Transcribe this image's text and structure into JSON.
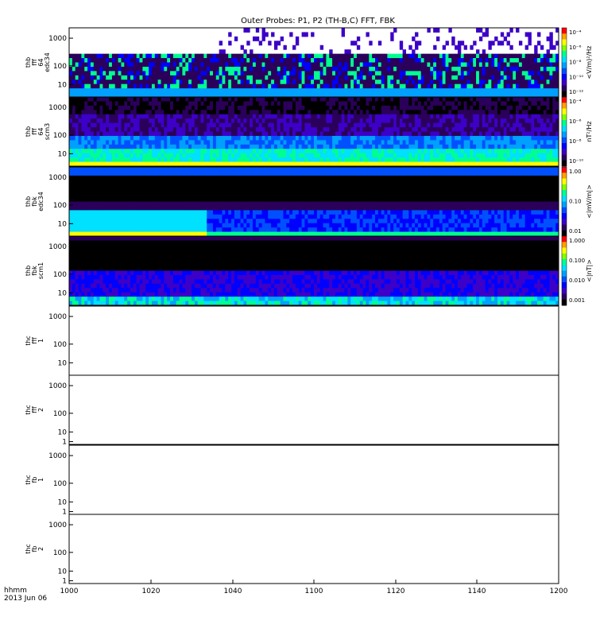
{
  "figure": {
    "title": "Outer Probes: P1, P2 (TH-B,C) FFT, FBK",
    "time_axis": {
      "ticks": [
        1000,
        1020,
        1040,
        1100,
        1120,
        1140,
        1200
      ],
      "tick_labels": [
        "1000",
        "1020",
        "1040",
        "1100",
        "1120",
        "1140",
        "1200"
      ],
      "unit_label": "hhmm",
      "date_label": "2013 Jun 06"
    }
  },
  "colors": {
    "axis": "#000000",
    "colormap": [
      "#000000",
      "#2a005a",
      "#3c00c8",
      "#0000ff",
      "#0050ff",
      "#00a0ff",
      "#00e0ff",
      "#00ff90",
      "#80ff00",
      "#ffff00",
      "#ffa000",
      "#ff0000"
    ]
  },
  "chart_data": [
    {
      "type": "heatmap",
      "ylabel": [
        "thb",
        "fff",
        "64",
        "edc34"
      ],
      "yscale": "log",
      "yticks": [
        "10",
        "100",
        "1000"
      ],
      "colorbar": {
        "label": "<V/m)²/Hz",
        "ticks": [
          "10⁻⁴",
          "10⁻⁶",
          "10⁻⁸",
          "10⁻¹⁰",
          "10⁻¹²"
        ]
      },
      "pattern": "sparse",
      "has_data": true
    },
    {
      "type": "heatmap",
      "ylabel": [
        "thb",
        "fff",
        "64",
        "scm3"
      ],
      "yscale": "log",
      "yticks": [
        "10",
        "100",
        "1000"
      ],
      "colorbar": {
        "label": "nT²/Hz",
        "ticks": [
          "10⁻⁴",
          "10⁻⁶",
          "10⁻⁸",
          "10⁻¹⁰"
        ]
      },
      "pattern": "dense",
      "has_data": true
    },
    {
      "type": "heatmap",
      "ylabel": [
        "thb",
        "fbk",
        "edc34"
      ],
      "yscale": "log",
      "yticks": [
        "10",
        "100",
        "1000"
      ],
      "colorbar": {
        "label": "<|mV/m|>",
        "ticks": [
          "1.00",
          "0.10",
          "0.01"
        ]
      },
      "pattern": "fbk_e",
      "has_data": true
    },
    {
      "type": "heatmap",
      "ylabel": [
        "thb",
        "fbk",
        "scm1"
      ],
      "yscale": "log",
      "yticks": [
        "10",
        "100",
        "1000"
      ],
      "colorbar": {
        "label": "<|nT|>",
        "ticks": [
          "1.000",
          "0.100",
          "0.010",
          "0.001"
        ]
      },
      "pattern": "fbk_b",
      "has_data": true
    },
    {
      "type": "heatmap",
      "ylabel": [
        "thc",
        "fff",
        "1"
      ],
      "yscale": "log",
      "yticks": [
        "10",
        "100",
        "1000"
      ],
      "has_data": false
    },
    {
      "type": "heatmap",
      "ylabel": [
        "thc",
        "fff",
        "2"
      ],
      "yscale": "log",
      "yticks": [
        "1",
        "10",
        "100",
        "1000"
      ],
      "has_data": false
    },
    {
      "type": "heatmap",
      "ylabel": [
        "thc",
        "fb",
        "1"
      ],
      "yscale": "log",
      "yticks": [
        "1",
        "10",
        "100",
        "1000"
      ],
      "has_data": false
    },
    {
      "type": "heatmap",
      "ylabel": [
        "thc",
        "fb",
        "2"
      ],
      "yscale": "log",
      "yticks": [
        "1",
        "10",
        "100",
        "1000"
      ],
      "has_data": false
    }
  ]
}
